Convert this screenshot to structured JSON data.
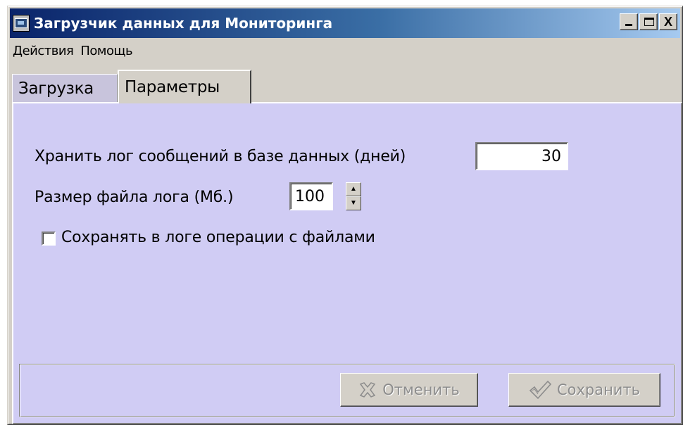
{
  "window": {
    "title": "Загрузчик данных для Мониторинга",
    "controls": {
      "minimize": "_",
      "maximize": "□",
      "close": "X"
    }
  },
  "menu": {
    "items": [
      "Действия",
      "Помощь"
    ]
  },
  "tabs": [
    {
      "label": "Загрузка",
      "active": false
    },
    {
      "label": "Параметры",
      "active": true
    }
  ],
  "settings": {
    "log_days_label": "Хранить лог сообщений в базе данных (дней)",
    "log_days_value": "30",
    "log_size_label": "Размер файла лога (Мб.)",
    "log_size_value": "100",
    "file_ops_label": "Сохранять в логе операции с файлами",
    "file_ops_checked": false
  },
  "buttons": {
    "cancel": "Отменить",
    "save": "Сохранить"
  },
  "colors": {
    "panel": "#d0ccf4",
    "face": "#d4d0c8",
    "title_start": "#0a246a",
    "title_end": "#a6caf0"
  }
}
